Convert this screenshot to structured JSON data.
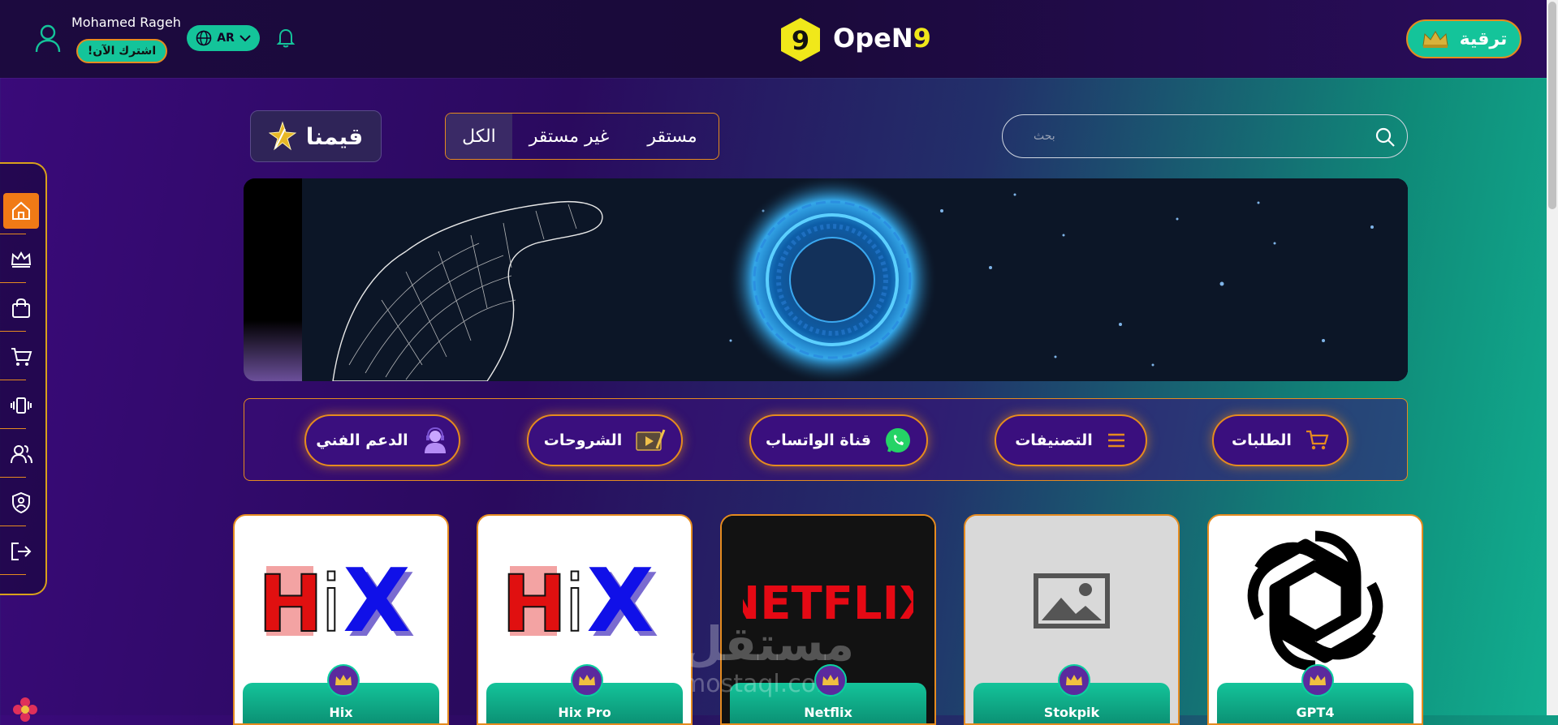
{
  "header": {
    "user_name": "Mohamed Rageh",
    "subscribe_label": "!اشترك الآن",
    "language": "AR",
    "logo_number": "9",
    "logo_text_main": "OpeN",
    "logo_text_accent": "9",
    "upgrade_label": "ترقية"
  },
  "sidebar": {
    "items": [
      {
        "icon": "home-icon",
        "active": true
      },
      {
        "icon": "crown-icon"
      },
      {
        "icon": "shopping-bag-icon"
      },
      {
        "icon": "cart-icon"
      },
      {
        "icon": "vibrate-icon"
      },
      {
        "icon": "users-icon"
      },
      {
        "icon": "shield-user-icon"
      },
      {
        "icon": "logout-icon"
      }
    ]
  },
  "filters": {
    "brand": "قيمنا",
    "tabs": [
      "الكل",
      "غير مستقر",
      "مستقر"
    ],
    "selected": "الكل",
    "search_placeholder": "بحث"
  },
  "actions": [
    {
      "label": "الدعم الفني",
      "icon": "support-agent-icon"
    },
    {
      "label": "الشروحات",
      "icon": "video-tutorial-icon"
    },
    {
      "label": "قناة الواتساب",
      "icon": "whatsapp-icon"
    },
    {
      "label": "التصنيفات",
      "icon": "menu-lines-icon"
    },
    {
      "label": "الطلبات",
      "icon": "cart-icon"
    }
  ],
  "products": [
    {
      "name": "Hix"
    },
    {
      "name": "Hix Pro"
    },
    {
      "name": "Netflix",
      "logo_text": "NETFLIX"
    },
    {
      "name": "Stokpik"
    },
    {
      "name": "GPT4"
    }
  ],
  "hix_logo_text": {
    "h": "H",
    "i": "i",
    "x": "X"
  },
  "watermark": {
    "main": "مستقل",
    "sub": "mostaql.com"
  },
  "colors": {
    "accent": "#e58b1f",
    "teal": "#14c49a",
    "gold": "#f0e81a"
  }
}
